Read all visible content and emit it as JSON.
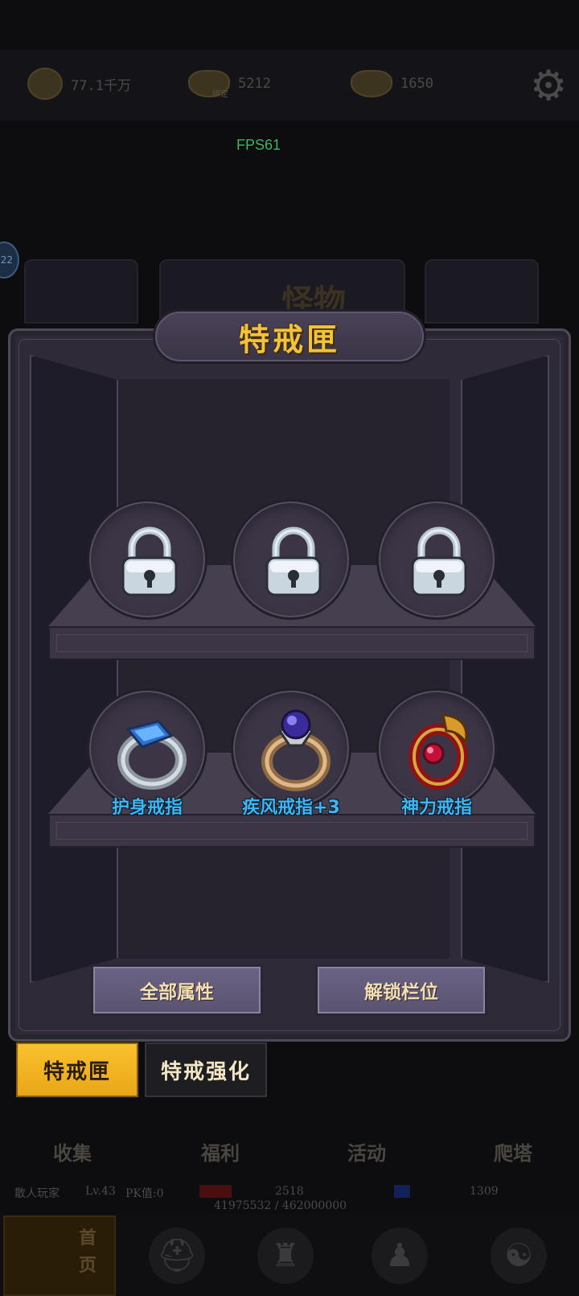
{
  "resources": {
    "copper": "77.1千万",
    "bound_gold_tag": "绑定",
    "bound_gold": "5212",
    "gold": "1650"
  },
  "fps": "FPS61",
  "side_badge": "22",
  "background_tab_text": "怪物",
  "panel": {
    "title": "特戒匣",
    "locked_slots": [
      {
        "state": "locked",
        "icon": "lock-icon"
      },
      {
        "state": "locked",
        "icon": "lock-icon"
      },
      {
        "state": "locked",
        "icon": "lock-icon"
      }
    ],
    "rings": [
      {
        "name": "护身戒指",
        "icon": "blue-gem-ring-icon"
      },
      {
        "name": "疾风戒指+3",
        "icon": "purple-gem-ring-icon"
      },
      {
        "name": "神力戒指",
        "icon": "red-dragon-ring-icon"
      }
    ],
    "buttons": {
      "all_attributes": "全部属性",
      "unlock_slot": "解锁栏位"
    }
  },
  "tabs": {
    "active": "特戒匣",
    "other": "特戒强化"
  },
  "subnav": [
    "收集",
    "福利",
    "活动",
    "爬塔"
  ],
  "status": {
    "player": "散人玩家",
    "level": "Lv.43",
    "pk": "PK值:0",
    "hp": "2518",
    "mp": "1309",
    "exp": "41975532 / 462000000"
  },
  "bottom_nav": {
    "home_label_1": "首",
    "home_label_2": "页"
  },
  "colors": {
    "title_gold": "#f2c33a",
    "ring_label_blue": "#3db6f2",
    "active_tab": "#f9c12e",
    "fps_green": "#3fb35f"
  }
}
